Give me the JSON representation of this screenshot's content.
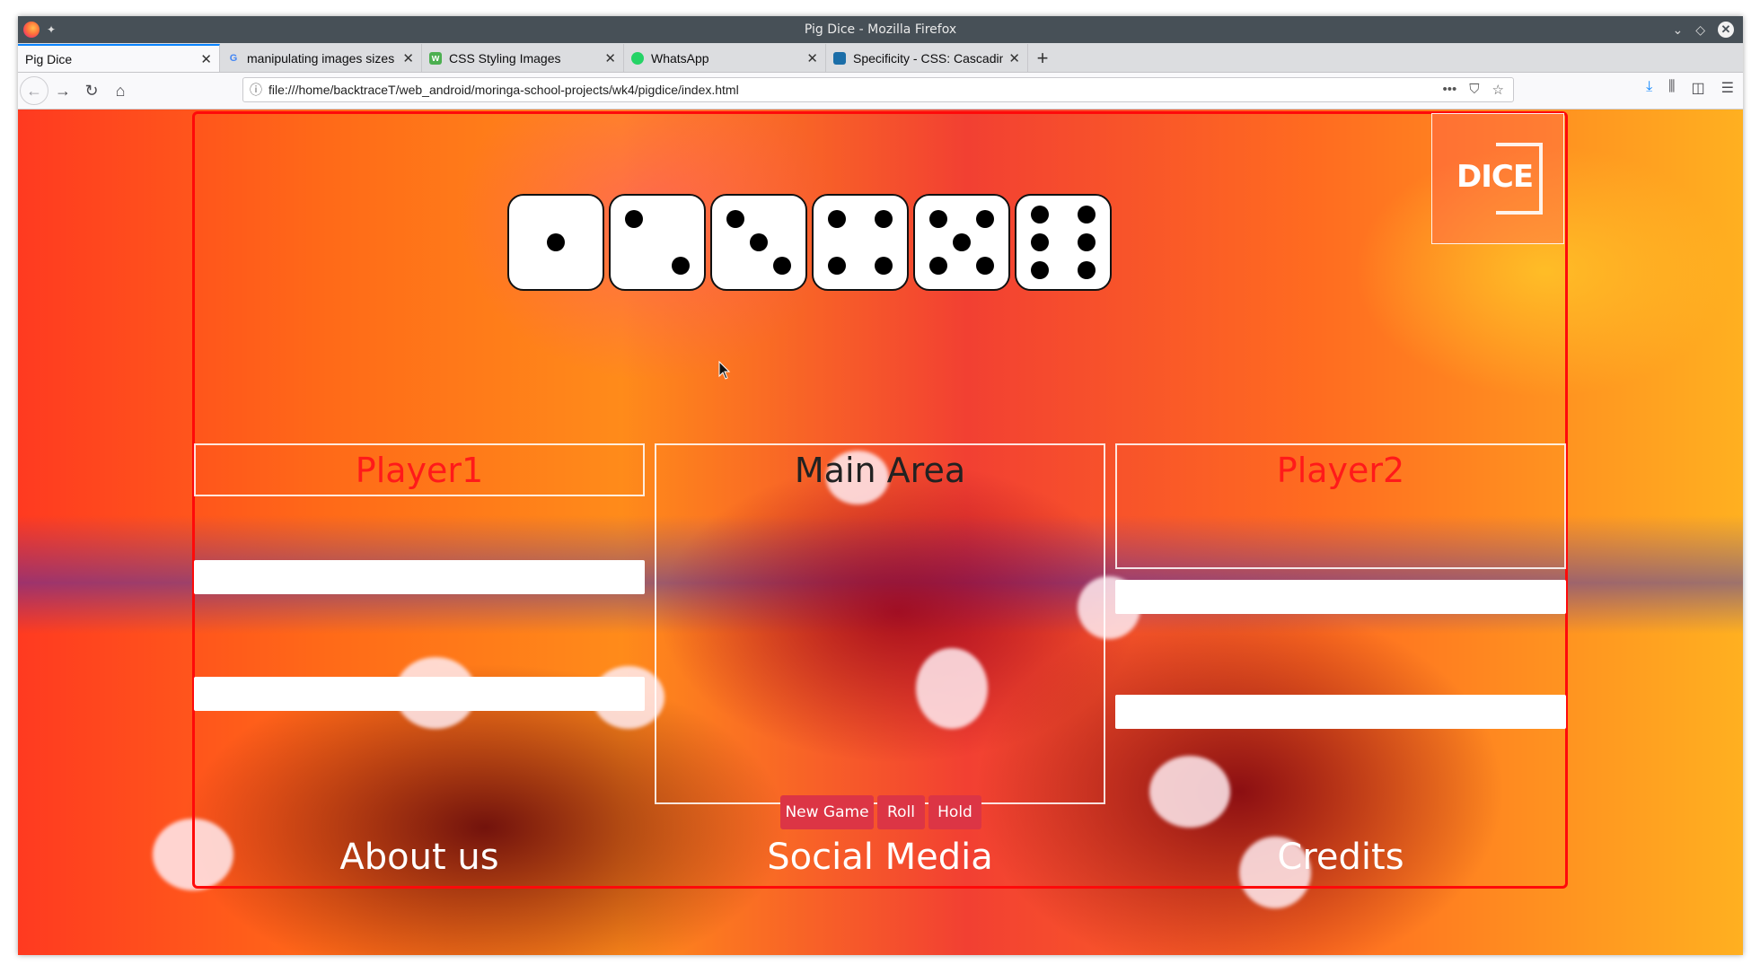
{
  "window": {
    "title": "Pig Dice - Mozilla Firefox"
  },
  "tabs": [
    {
      "label": "Pig Dice",
      "favicon": "none",
      "active": true
    },
    {
      "label": "manipulating images sizes",
      "favicon": "google-icon",
      "active": false
    },
    {
      "label": "CSS Styling Images",
      "favicon": "w3schools-icon",
      "active": false
    },
    {
      "label": "WhatsApp",
      "favicon": "whatsapp-icon",
      "active": false
    },
    {
      "label": "Specificity - CSS: Cascading",
      "favicon": "mdn-icon",
      "active": false
    }
  ],
  "url": "file:///home/backtraceT/web_android/moringa-school-projects/wk4/pigdice/index.html",
  "page": {
    "logo_text": "DICE",
    "dice": [
      1,
      2,
      3,
      4,
      5,
      6
    ],
    "player1_title": "Player1",
    "main_area_title": "Main Area",
    "player2_title": "Player2",
    "buttons": {
      "new_game": "New Game",
      "roll": "Roll",
      "hold": "Hold"
    },
    "footer": {
      "about": "About us",
      "social": "Social Media",
      "credits": "Credits"
    }
  },
  "colors": {
    "frame": "#ff0a0a",
    "button": "#dc3545",
    "player_title": "#ff1a1a",
    "tab_accent": "#0a84ff"
  }
}
